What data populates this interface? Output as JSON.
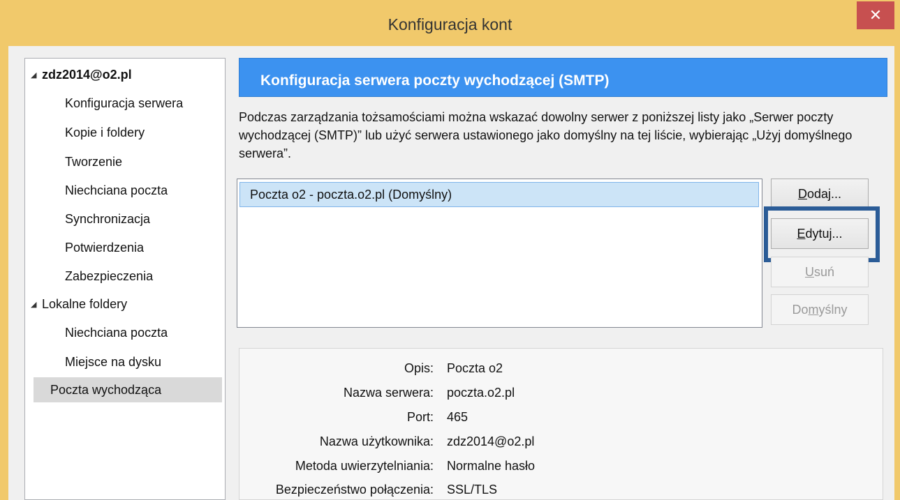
{
  "window": {
    "title": "Konfiguracja kont",
    "close_glyph": "✕"
  },
  "tree": {
    "account": {
      "label": "zdz2014@o2.pl",
      "children": [
        "Konfiguracja serwera",
        "Kopie i foldery",
        "Tworzenie",
        "Niechciana poczta",
        "Synchronizacja",
        "Potwierdzenia",
        "Zabezpieczenia"
      ]
    },
    "local": {
      "label": "Lokalne foldery",
      "children": [
        "Niechciana poczta",
        "Miejsce na dysku"
      ]
    },
    "outgoing": {
      "label": "Poczta wychodząca"
    },
    "expand_glyph": "◢"
  },
  "panel": {
    "title": "Konfiguracja serwera poczty wychodzącej (SMTP)",
    "description": "Podczas zarządzania tożsamościami można wskazać dowolny serwer z poniższej listy jako „Serwer poczty wychodzącej (SMTP)” lub użyć serwera ustawionego jako domyślny na tej liście, wybierając „Użyj domyślnego serwera”.",
    "servers": [
      "Poczta o2 - poczta.o2.pl (Domyślny)"
    ],
    "buttons": {
      "add": {
        "pre": "",
        "key": "D",
        "post": "odaj..."
      },
      "edit": {
        "pre": "",
        "key": "E",
        "post": "dytuj..."
      },
      "remove": {
        "pre": "",
        "key": "U",
        "post": "suń"
      },
      "default": {
        "pre": "Do",
        "key": "m",
        "post": "yślny"
      }
    },
    "details": {
      "description_label": "Opis:",
      "description_value": "Poczta o2",
      "server_label": "Nazwa serwera:",
      "server_value": "poczta.o2.pl",
      "port_label": "Port:",
      "port_value": "465",
      "user_label": "Nazwa użytkownika:",
      "user_value": "zdz2014@o2.pl",
      "auth_label": "Metoda uwierzytelniania:",
      "auth_value": "Normalne hasło",
      "security_label": "Bezpieczeństwo połączenia:",
      "security_value": "SSL/TLS"
    }
  },
  "colors": {
    "titlebar": "#f1c96b",
    "banner": "#3c92f0",
    "close": "#c75050",
    "highlight": "#2b5c97"
  }
}
